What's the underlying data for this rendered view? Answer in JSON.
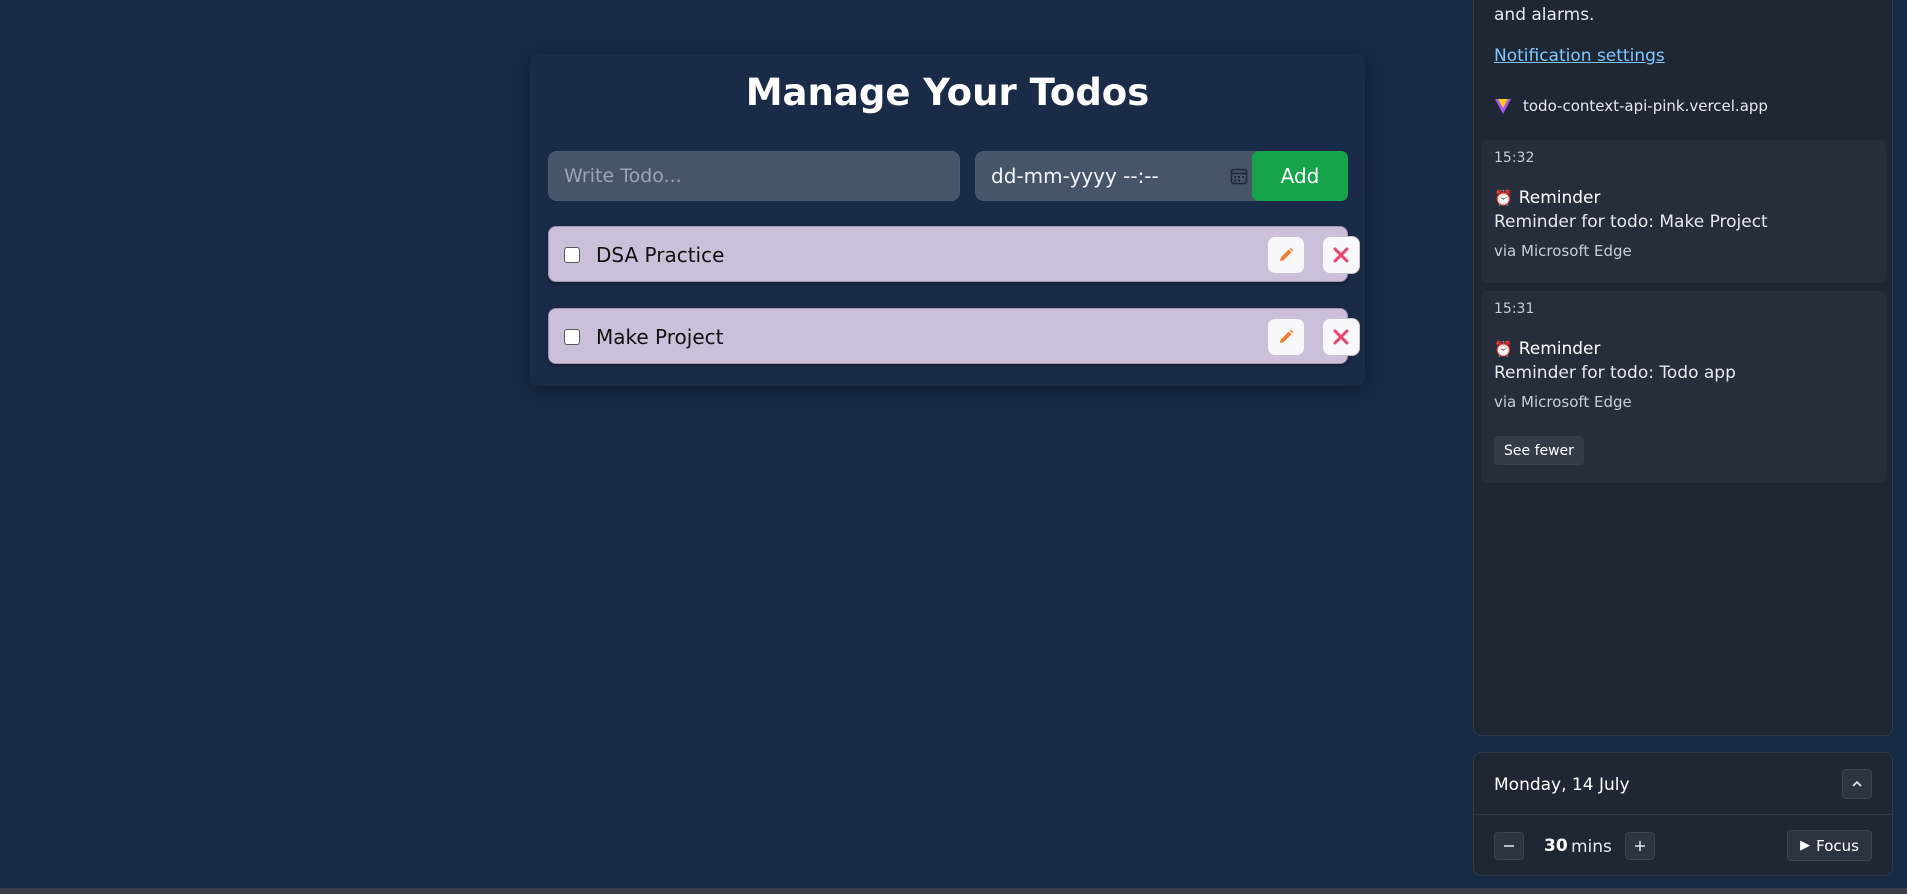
{
  "todo_app": {
    "title": "Manage Your Todos",
    "input_placeholder": "Write Todo...",
    "date_placeholder": "dd-mm-yyyy --:--",
    "add_label": "Add",
    "items": [
      {
        "text": "DSA Practice",
        "checked": false
      },
      {
        "text": "Make Project",
        "checked": false
      }
    ],
    "colors": {
      "background": "#172a46",
      "item_background": "#ccbfd9",
      "add_button": "#16a34a",
      "edit_icon": "#f07b2a",
      "delete_icon": "#e8436e"
    }
  },
  "notifications": {
    "truncated_text": "and alarms.",
    "settings_link": "Notification settings",
    "site": "todo-context-api-pink.vercel.app",
    "items": [
      {
        "time": "15:32",
        "title": "Reminder",
        "body": "Reminder for todo: Make Project",
        "source": "via Microsoft Edge"
      },
      {
        "time": "15:31",
        "title": "Reminder",
        "body": "Reminder for todo: Todo app",
        "source": "via Microsoft Edge"
      }
    ],
    "see_fewer_label": "See fewer"
  },
  "focus": {
    "date": "Monday, 14 July",
    "minutes": "30",
    "unit": "mins",
    "focus_label": "Focus"
  }
}
